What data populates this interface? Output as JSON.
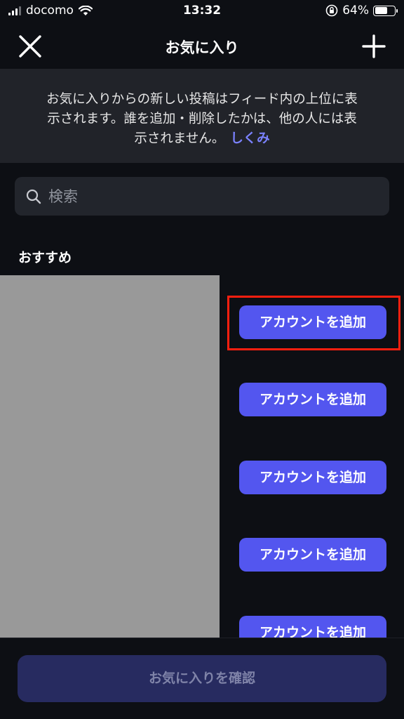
{
  "status_bar": {
    "carrier": "docomo",
    "time": "13:32",
    "battery": "64%",
    "battery_level": 0.64
  },
  "header": {
    "title": "お気に入り",
    "close_icon": "close-icon",
    "add_icon": "plus-icon"
  },
  "info": {
    "text_line1": "お気に入りからの新しい投稿はフィード内の上位に表",
    "text_line2": "示されます。誰を追加・削除したかは、他の人には表",
    "text_line3": "示されません。",
    "link_label": "しくみ"
  },
  "search": {
    "placeholder": "検索"
  },
  "recommended": {
    "title": "おすすめ",
    "buttons": [
      {
        "label": "アカウントを追加"
      },
      {
        "label": "アカウントを追加"
      },
      {
        "label": "アカウントを追加"
      },
      {
        "label": "アカウントを追加"
      },
      {
        "label": "アカウントを追加"
      }
    ]
  },
  "footer": {
    "confirm_label": "お気に入りを確認"
  },
  "colors": {
    "accent": "#5356ef",
    "link": "#7b82ff",
    "highlight": "#ff1f0f"
  }
}
